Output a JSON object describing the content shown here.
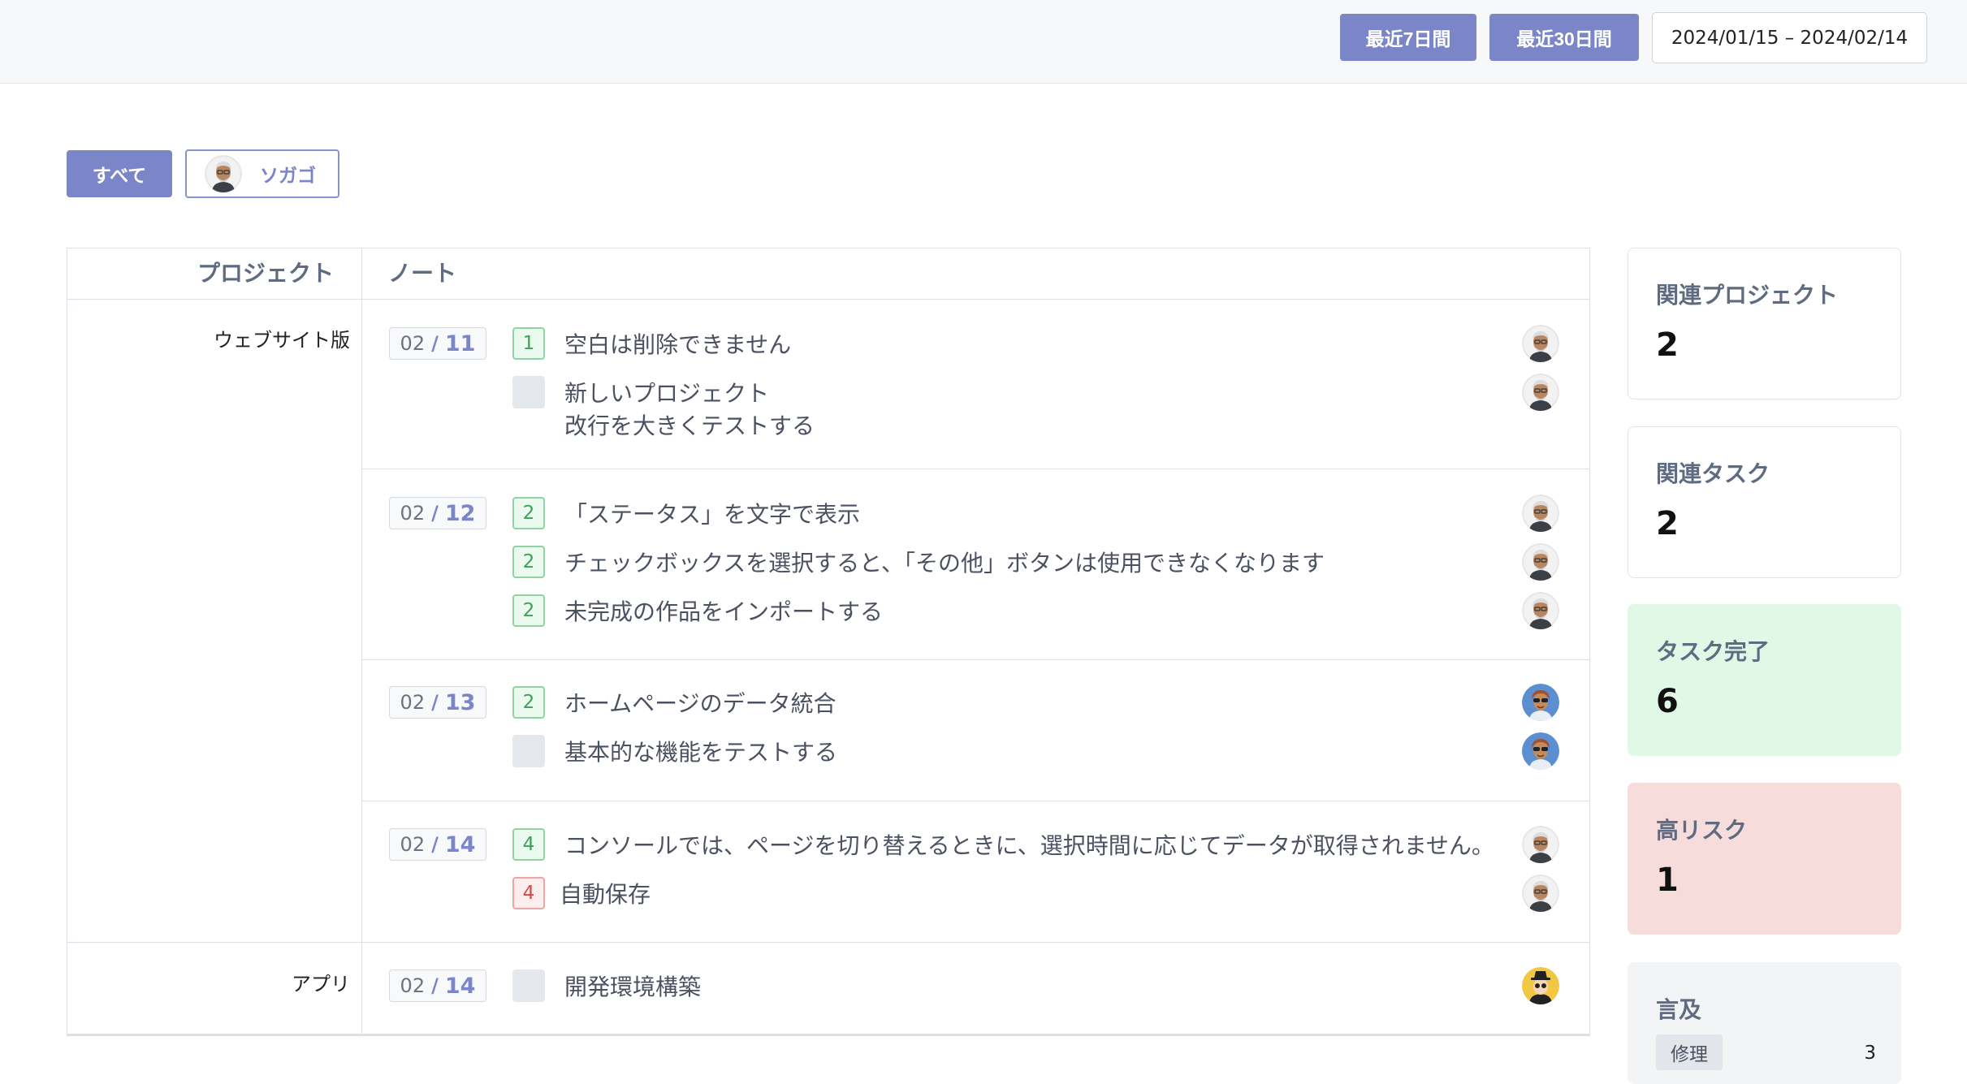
{
  "header": {
    "btn_7days": "最近7日間",
    "btn_30days": "最近30日間",
    "date_range": "2024/01/15 – 2024/02/14"
  },
  "filter": {
    "all_label": "すべて",
    "user_label": "ソガゴ"
  },
  "table": {
    "col_project": "プロジェクト",
    "col_note": "ノート",
    "projects": [
      {
        "name": "ウェブサイト版",
        "days": [
          {
            "month": "02",
            "sep": "/",
            "day": "11",
            "tasks": [
              {
                "count": "1",
                "text": "空白は削除できません",
                "avatar": "bald-man"
              },
              {
                "count": "",
                "text": "新しいプロジェクト",
                "text2": "改行を大きくテストする",
                "avatar": "bald-man"
              }
            ]
          },
          {
            "month": "02",
            "sep": "/",
            "day": "12",
            "tasks": [
              {
                "count": "2",
                "text": "「ステータス」を文字で表示",
                "avatar": "bald-man"
              },
              {
                "count": "2",
                "text": "チェックボックスを選択すると、「その他」ボタンは使用できなくなります",
                "avatar": "bald-man"
              },
              {
                "count": "2",
                "text": "未完成の作品をインポートする",
                "avatar": "bald-man"
              }
            ]
          },
          {
            "month": "02",
            "sep": "/",
            "day": "13",
            "tasks": [
              {
                "count": "2",
                "text": "ホームページのデータ統合",
                "avatar": "sunglasses-man"
              },
              {
                "count": "",
                "text": "基本的な機能をテストする",
                "avatar": "sunglasses-man"
              }
            ]
          },
          {
            "month": "02",
            "sep": "/",
            "day": "14",
            "tasks": [
              {
                "count": "4",
                "text": "コンソールでは、ページを切り替えるときに、選択時間に応じてデータが取得されません。",
                "avatar": "bald-man"
              },
              {
                "count": "4",
                "text": "自動保存",
                "avatar": "bald-man",
                "risk": true
              }
            ]
          }
        ]
      },
      {
        "name": "アプリ",
        "days": [
          {
            "month": "02",
            "sep": "/",
            "day": "14",
            "tasks": [
              {
                "count": "",
                "text": "開発環境構築",
                "avatar": "hat-person"
              }
            ]
          }
        ]
      }
    ]
  },
  "stats": {
    "related_projects": {
      "label": "関連プロジェクト",
      "value": "2"
    },
    "related_tasks": {
      "label": "関連タスク",
      "value": "2"
    },
    "tasks_done": {
      "label": "タスク完了",
      "value": "6",
      "color": "#e2f8e6"
    },
    "high_risk": {
      "label": "高リスク",
      "value": "1",
      "color": "#f7dcdc"
    },
    "mentions": {
      "label": "言及",
      "tag": "修理",
      "count": "3"
    }
  },
  "colors": {
    "accent": "#7b86c8",
    "green": "#3f9f5a",
    "red": "#d04a4a"
  }
}
